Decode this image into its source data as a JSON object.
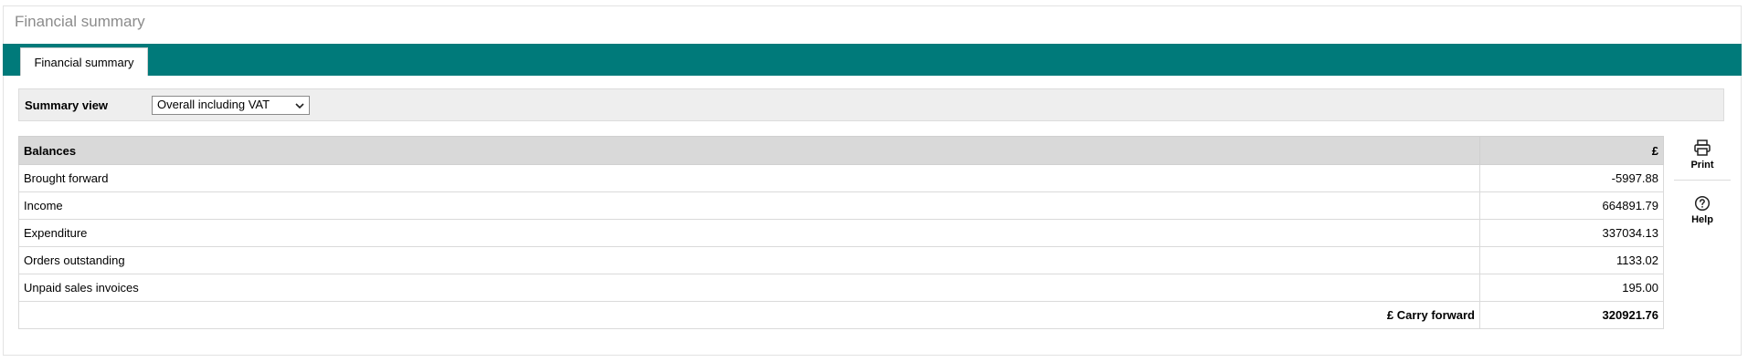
{
  "page": {
    "title": "Financial summary"
  },
  "tabs": [
    {
      "label": "Financial summary",
      "active": true
    }
  ],
  "filter": {
    "label": "Summary view",
    "selected": "Overall including VAT"
  },
  "balances": {
    "header": {
      "label": "Balances",
      "currency": "£"
    },
    "rows": [
      {
        "label": "Brought forward",
        "value": "-5997.88"
      },
      {
        "label": "Income",
        "value": "664891.79"
      },
      {
        "label": "Expenditure",
        "value": "337034.13"
      },
      {
        "label": "Orders outstanding",
        "value": "1133.02"
      },
      {
        "label": "Unpaid sales invoices",
        "value": "195.00"
      }
    ],
    "total": {
      "label": "£ Carry forward",
      "value": "320921.76"
    }
  },
  "actions": {
    "print": {
      "label": "Print",
      "icon": "printer-icon"
    },
    "help": {
      "label": "Help",
      "icon": "question-circle-icon"
    }
  },
  "colors": {
    "tab_bar": "#007a7a",
    "table_header": "#d9d9d9",
    "filter_bg": "#eeeeee"
  }
}
